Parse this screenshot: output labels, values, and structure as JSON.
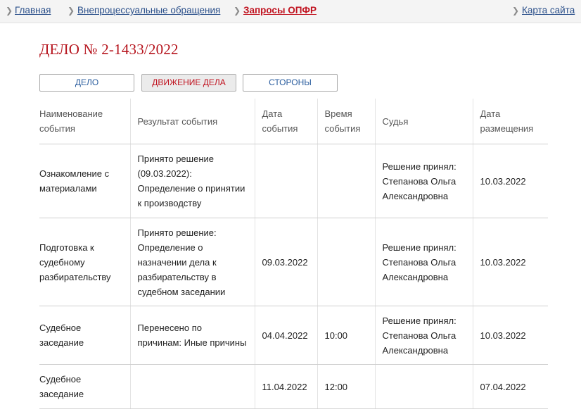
{
  "breadcrumbs": [
    "Главная",
    "Внепроцессуальные обращения",
    "Запросы ОПФР"
  ],
  "sitemap_label": "Карта сайта",
  "case_title": "ДЕЛО № 2-1433/2022",
  "tabs": [
    "ДЕЛО",
    "ДВИЖЕНИЕ ДЕЛА",
    "СТОРОНЫ"
  ],
  "active_tab": "ДВИЖЕНИЕ ДЕЛА",
  "table": {
    "columns": [
      "Наименование события",
      "Результат события",
      "Дата события",
      "Время события",
      "Судья",
      "Дата размещения"
    ],
    "rows": [
      {
        "event": "Ознакомление с материалами",
        "result": "Принято решение (09.03.2022): Определение о принятии к производству",
        "date": "",
        "time": "",
        "judge": "Решение принял: Степанова Ольга Александровна",
        "posted": "10.03.2022"
      },
      {
        "event": "Подготовка к судебному разбирательству",
        "result": "Принято решение: Определение о назначении дела к разбирательству в судебном заседании",
        "date": "09.03.2022",
        "time": "",
        "judge": "Решение принял: Степанова Ольга Александровна",
        "posted": "10.03.2022"
      },
      {
        "event": "Судебное заседание",
        "result": "Перенесено по причинам: Иные причины",
        "date": "04.04.2022",
        "time": "10:00",
        "judge": "Решение принял: Степанова Ольга Александровна",
        "posted": "10.03.2022"
      },
      {
        "event": "Судебное заседание",
        "result": "",
        "date": "11.04.2022",
        "time": "12:00",
        "judge": "",
        "posted": "07.04.2022"
      }
    ]
  }
}
